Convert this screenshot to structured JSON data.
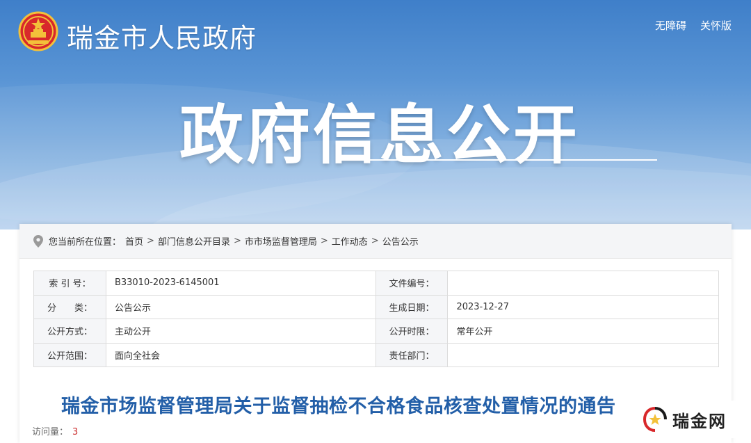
{
  "header": {
    "site_name": "瑞金市人民政府",
    "links": [
      "无障碍",
      "关怀版"
    ],
    "banner_title": "政府信息公开"
  },
  "breadcrumb": {
    "lead": "您当前所在位置：",
    "items": [
      "首页",
      "部门信息公开目录",
      "市市场监督管理局",
      "工作动态",
      "公告公示"
    ]
  },
  "info_table": {
    "rows": [
      {
        "k1": "索 引 号：",
        "v1": "B33010-2023-6145001",
        "k2": "文件编号：",
        "v2": ""
      },
      {
        "k1": "分　　类：",
        "v1": "公告公示",
        "k2": "生成日期：",
        "v2": "2023-12-27"
      },
      {
        "k1": "公开方式：",
        "v1": "主动公开",
        "k2": "公开时限：",
        "v2": "常年公开"
      },
      {
        "k1": "公开范围：",
        "v1": "面向全社会",
        "k2": "责任部门：",
        "v2": ""
      }
    ]
  },
  "article": {
    "title": "瑞金市场监督管理局关于监督抽检不合格食品核查处置情况的通告",
    "views_label": "访问量：",
    "views_count": "3"
  },
  "watermark": {
    "text": "瑞金网"
  },
  "colors": {
    "banner": "#4a86cc",
    "title_blue": "#235fa8",
    "count_red": "#cc3333"
  }
}
